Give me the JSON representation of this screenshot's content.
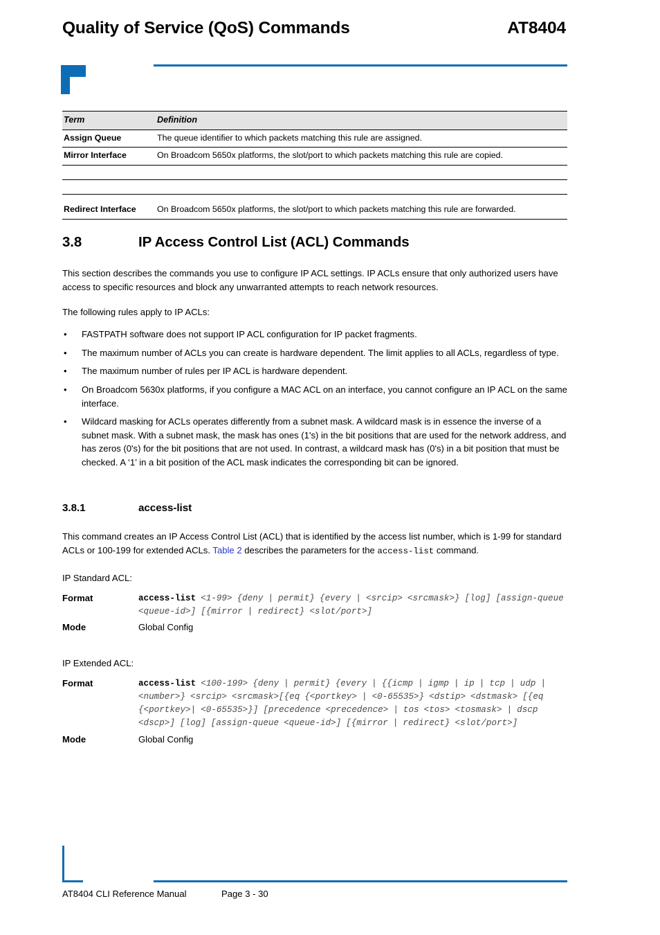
{
  "brand_color": "#0d6cb6",
  "link_color": "#2437cf",
  "header": {
    "title": "Quality of Service (QoS) Commands",
    "model": "AT8404"
  },
  "term_table": {
    "columns": [
      "Term",
      "Definition"
    ],
    "rows": [
      {
        "term": "Assign Queue",
        "definition": "The queue identifier to which packets matching this rule are assigned."
      },
      {
        "term": "Mirror Interface",
        "definition": "On Broadcom 5650x platforms, the slot/port  to which packets matching this rule are copied."
      },
      {
        "term": "",
        "definition": ""
      },
      {
        "term": "Redirect Interface",
        "definition": "On Broadcom 5650x platforms, the slot/port to which packets matching this rule are forwarded."
      }
    ]
  },
  "section": {
    "number": "3.8",
    "title": "IP Access Control List (ACL) Commands",
    "intro": "This section describes the commands you use to configure IP ACL settings. IP ACLs ensure that only authorized users have access to specific resources and block any unwarranted attempts to reach network resources.",
    "rules_lead": "The following rules apply to IP ACLs:",
    "bullet_marker": "•",
    "rules": [
      "FASTPATH software does not support IP ACL configuration for IP packet fragments.",
      "The maximum number of ACLs you can create is hardware dependent. The limit applies to all ACLs, regardless of type.",
      "The maximum number of rules per IP ACL is hardware dependent.",
      "On Broadcom 5630x platforms, if you configure a MAC ACL on an interface, you cannot configure an IP ACL on the same interface.",
      "Wildcard masking for ACLs operates differently from a subnet mask. A wildcard mask is in essence the inverse of a subnet mask. With a subnet mask, the mask has ones (1's) in the bit positions that are used for the network address, and has zeros (0's) for the bit positions that are not used. In contrast, a wildcard mask has (0's) in a bit position that must be checked. A ‘1’ in a bit position of the ACL mask indicates the corresponding bit can be ignored."
    ]
  },
  "subsection": {
    "number": "3.8.1",
    "title": "access-list",
    "description_part1": "This command creates an IP Access Control List (ACL) that is identified by the access list number, which is 1-99 for standard ACLs or 100-199 for extended ACLs",
    "description_sep": ". ",
    "table_link": "Table 2",
    "description_part2": " describes the parameters for the ",
    "command_name": "access-list",
    "description_part3": " command."
  },
  "standard_acl": {
    "intro": "IP Standard ACL:",
    "format_label": "Format",
    "command": "access-list",
    "syntax": " <1-99> {deny | permit} {every | <srcip> <srcmask>} [log] [assign-queue <queue-id>] [{mirror | redirect} <slot/port>]",
    "mode_label": "Mode",
    "mode_value": "Global Config"
  },
  "extended_acl": {
    "intro": "IP Extended ACL:",
    "format_label": "Format",
    "command": "access-list",
    "syntax": " <100-199> {deny | permit} {every | {{icmp | igmp | ip | tcp | udp | <number>} <srcip> <srcmask>[{eq {<portkey> | <0-65535>} <dstip> <dstmask> [{eq {<portkey>| <0-65535>}] [precedence <precedence> | tos <tos> <tosmask> | dscp <dscp>] [log] [assign-queue <queue-id>] [{mirror | redirect} <slot/port>]",
    "mode_label": "Mode",
    "mode_value": "Global Config"
  },
  "footer": {
    "manual": "AT8404 CLI Reference Manual",
    "page": "Page 3 - 30"
  }
}
